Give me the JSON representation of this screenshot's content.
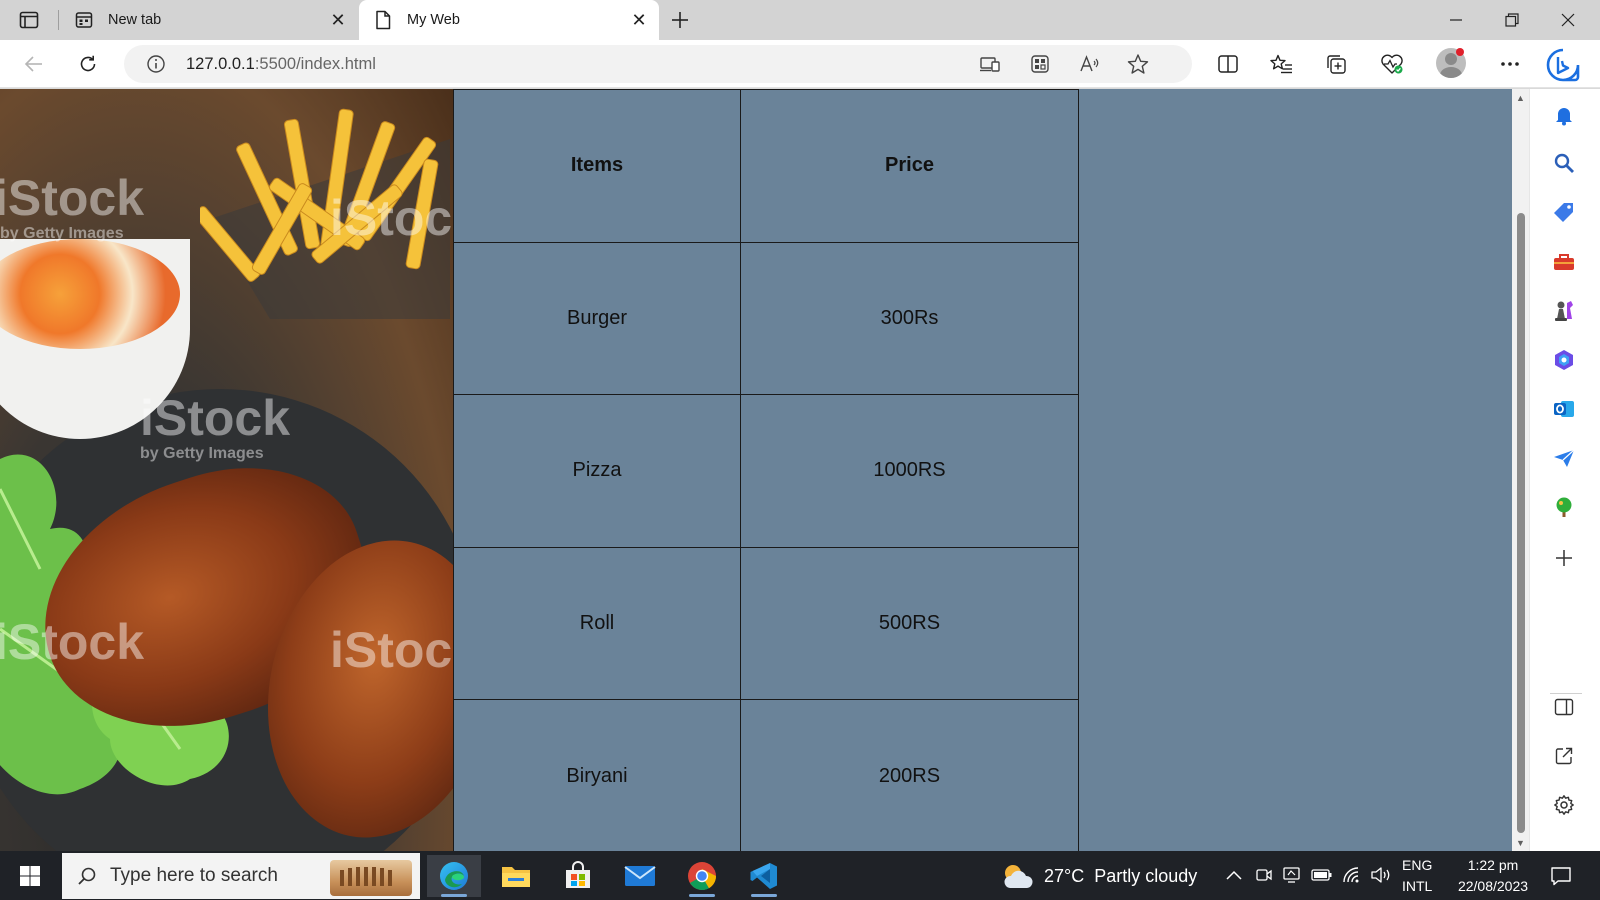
{
  "browser": {
    "tabs": [
      {
        "title": "New tab",
        "active": false,
        "icon": "new-tab-page-icon"
      },
      {
        "title": "My Web",
        "active": true,
        "icon": "document-icon"
      }
    ],
    "url_host": "127.0.0.1",
    "url_rest": ":5500/index.html"
  },
  "page": {
    "background_color": "#6a8399",
    "image_watermarks": [
      "iStock",
      "by Getty Images"
    ],
    "table": {
      "headers": [
        "Items",
        "Price"
      ],
      "rows": [
        [
          "Burger",
          "300Rs"
        ],
        [
          "Pizza",
          "1000RS"
        ],
        [
          "Roll",
          "500RS"
        ],
        [
          "Biryani",
          "200RS"
        ]
      ]
    }
  },
  "taskbar": {
    "search_placeholder": "Type here to search",
    "weather": "27°C  Partly cloudy",
    "lang_line1": "ENG",
    "lang_line2": "INTL",
    "time": "1:22 pm",
    "date": "22/08/2023"
  }
}
